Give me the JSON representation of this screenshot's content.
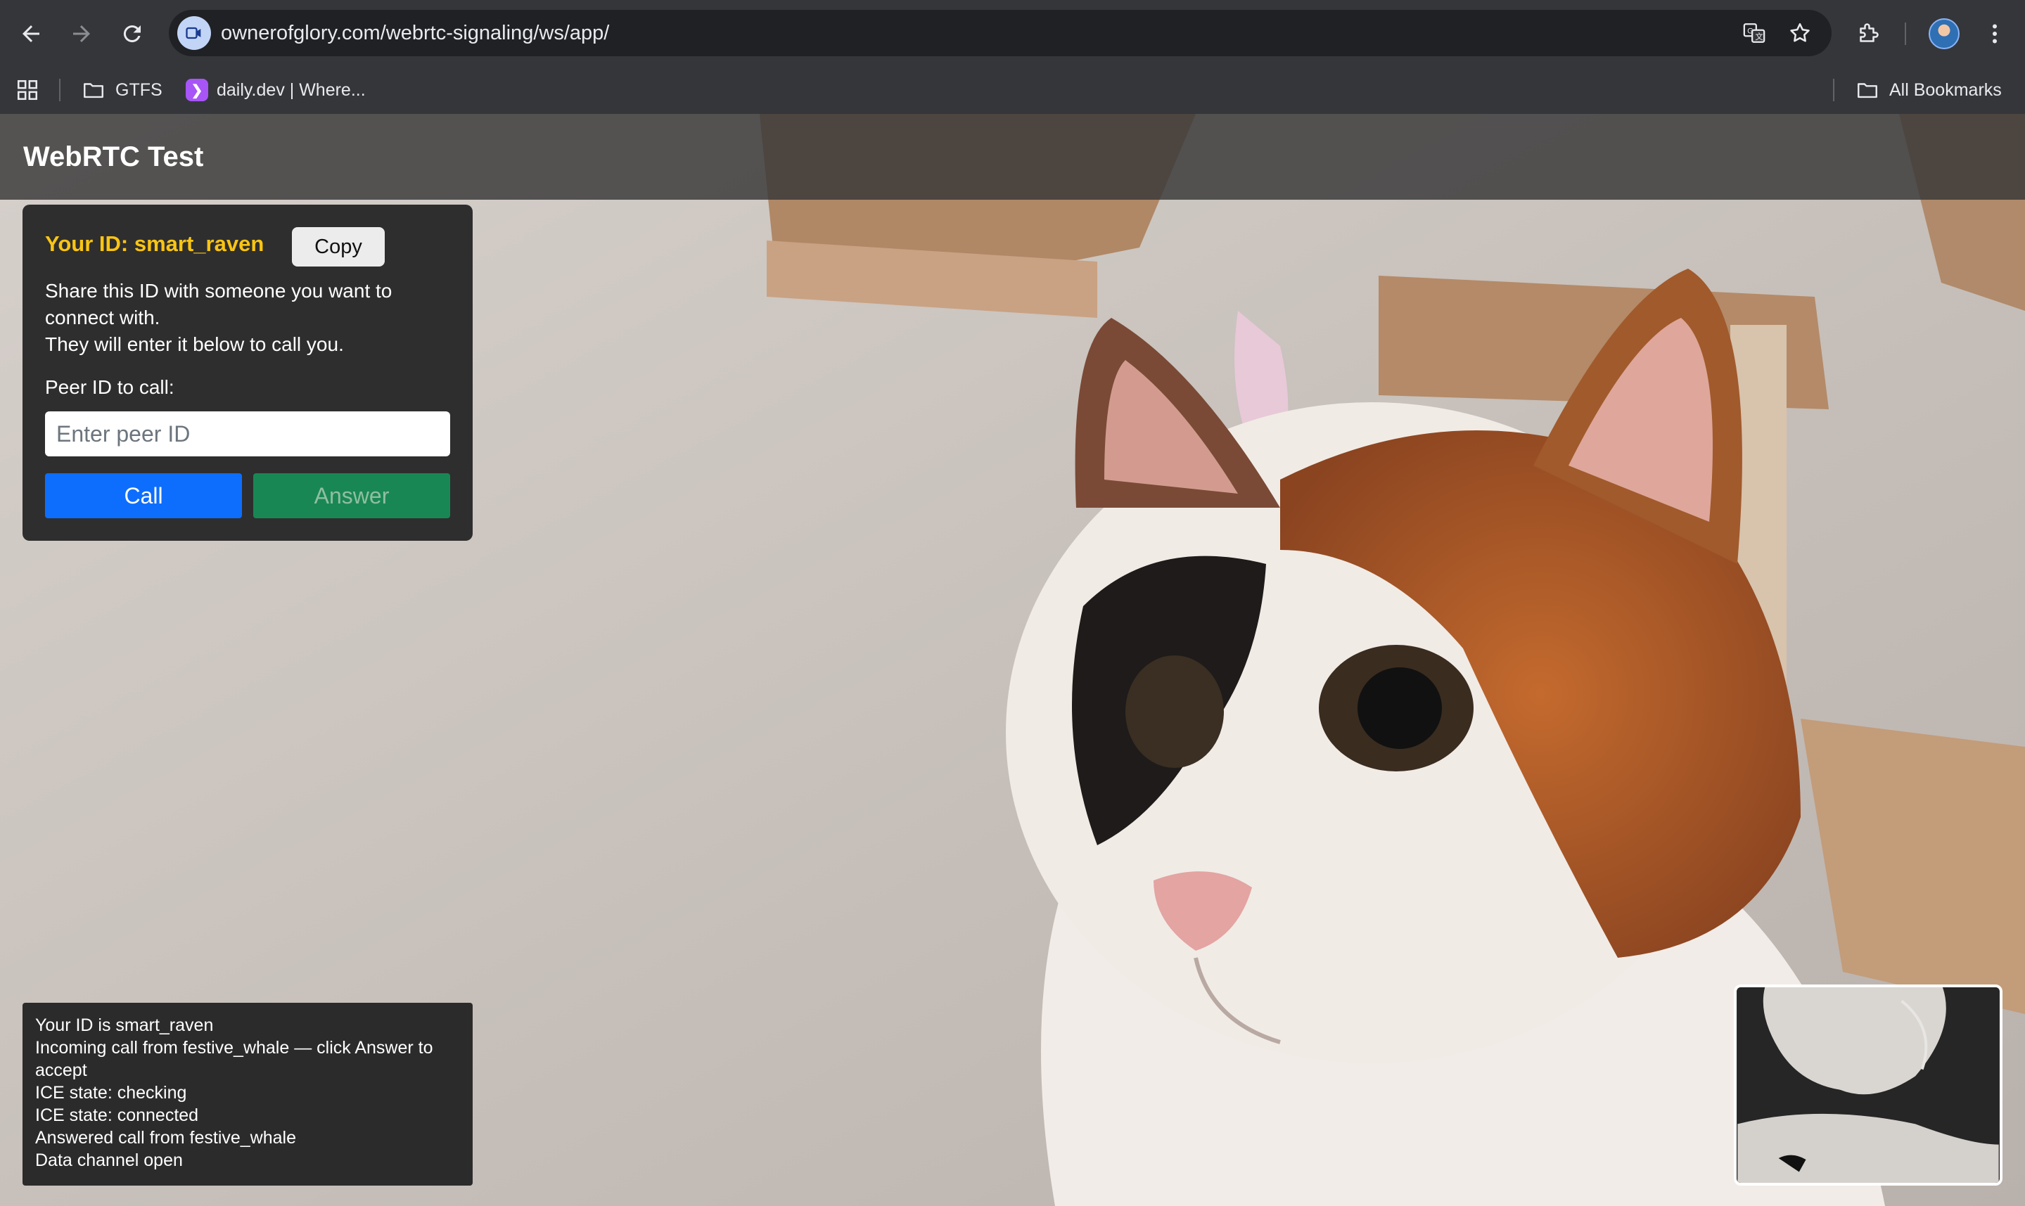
{
  "browser": {
    "url": "ownerofglory.com/webrtc-signaling/ws/app/",
    "bookmarks": [
      {
        "label": "GTFS",
        "icon": "folder-icon"
      },
      {
        "label": "daily.dev | Where...",
        "icon": "dailydev-icon"
      }
    ],
    "all_bookmarks_label": "All Bookmarks"
  },
  "app": {
    "title": "WebRTC Test",
    "id_line": "Your ID: smart_raven",
    "copy_label": "Copy",
    "share_text": [
      "Share this ID with someone you want to connect with.",
      "They will enter it below to call you."
    ],
    "peer_label": "Peer ID to call:",
    "peer_input": {
      "value": "",
      "placeholder": "Enter peer ID"
    },
    "call_label": "Call",
    "answer_label": "Answer"
  },
  "log": [
    "Your ID is smart_raven",
    "Incoming call from festive_whale — click Answer to accept",
    "ICE state: checking",
    "ICE state: connected",
    "Answered call from festive_whale",
    "Data channel open"
  ],
  "colors": {
    "id_accent": "#f9c513",
    "call_button": "#0d6efd",
    "answer_button": "#198754"
  }
}
